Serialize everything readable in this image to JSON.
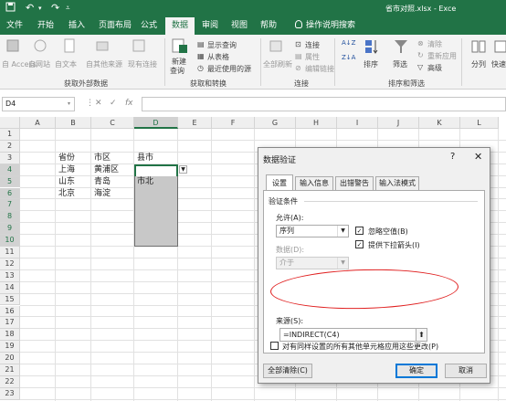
{
  "titlebar": {
    "title": "省市对照.xlsx  -  Exce"
  },
  "tabs": [
    "文件",
    "开始",
    "插入",
    "页面布局",
    "公式",
    "数据",
    "审阅",
    "视图",
    "帮助",
    "操作说明搜索"
  ],
  "ribbon": {
    "get_external": {
      "items": [
        "自 Access",
        "自网站",
        "自文本",
        "自其他来源",
        "现有连接"
      ],
      "label": "获取外部数据"
    },
    "get_transform": {
      "new_query_1": "新建",
      "new_query_2": "查询",
      "show_query": "显示查询",
      "from_table": "从表格",
      "recent_sources": "最近使用的源",
      "label": "获取和转换"
    },
    "connections": {
      "refresh_all": "全部刷新",
      "connections": "连接",
      "properties": "属性",
      "edit_links": "编辑链接",
      "label": "连接"
    },
    "sort_filter": {
      "sort_az": "A↓Z",
      "sort_za": "Z↓A",
      "sort": "排序",
      "filter": "筛选",
      "clear": "清除",
      "reapply": "重新应用",
      "advanced": "高级",
      "label": "排序和筛选"
    },
    "tools": {
      "split": "分列",
      "quick": "快速"
    }
  },
  "formula_bar": {
    "name_box": "D4",
    "cancel": "✕",
    "enter": "✓",
    "fx": "fx",
    "formula": ""
  },
  "sheet": {
    "columns": [
      "A",
      "B",
      "C",
      "D",
      "E",
      "F",
      "G",
      "H",
      "I",
      "J",
      "K",
      "L"
    ],
    "rows": [
      "1",
      "2",
      "3",
      "4",
      "5",
      "6",
      "7",
      "8",
      "9",
      "10",
      "11",
      "12",
      "13",
      "14",
      "15",
      "16",
      "17",
      "18",
      "19",
      "20",
      "21",
      "22",
      "23"
    ],
    "cells": {
      "B3": "省份",
      "C3": "市区",
      "D3": "县市",
      "B4": "上海",
      "C4": "黄浦区",
      "B5": "山东",
      "C5": "青岛",
      "D5": "市北",
      "B6": "北京",
      "C6": "海淀"
    }
  },
  "dialog": {
    "title": "数据验证",
    "help": "?",
    "close": "✕",
    "tabs": [
      "设置",
      "输入信息",
      "出错警告",
      "输入法模式"
    ],
    "criteria_label": "验证条件",
    "allow_label": "允许(A):",
    "allow_value": "序列",
    "data_label": "数据(D):",
    "data_value": "介于",
    "ignore_blank": "忽略空值(B)",
    "dropdown": "提供下拉箭头(I)",
    "source_label": "来源(S):",
    "source_value": "=INDIRECT(C4)",
    "apply_all": "对有同样设置的所有其他单元格应用这些更改(P)",
    "clear_all": "全部清除(C)",
    "ok": "确定",
    "cancel": "取消"
  }
}
